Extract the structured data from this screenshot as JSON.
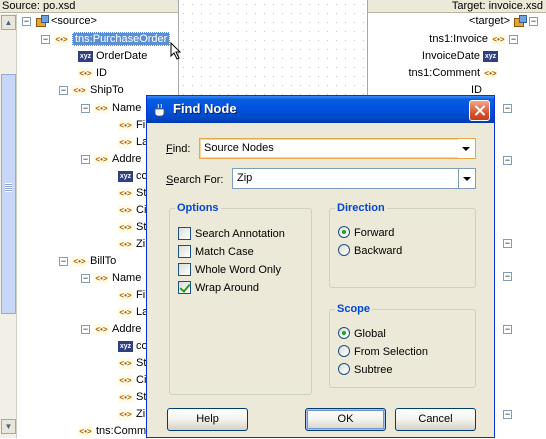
{
  "source": {
    "header": "Source: po.xsd",
    "tree": [
      {
        "label": "<source>",
        "kind": "root"
      },
      {
        "label": "tns:PurchaseOrder",
        "kind": "element",
        "selected": true
      },
      {
        "label": "OrderDate",
        "kind": "attribute"
      },
      {
        "label": "ID",
        "kind": "element"
      },
      {
        "label": "ShipTo",
        "kind": "element"
      },
      {
        "label": "Name",
        "kind": "element"
      },
      {
        "label": "Fi",
        "kind": "element"
      },
      {
        "label": "La",
        "kind": "element"
      },
      {
        "label": "Addre",
        "kind": "element"
      },
      {
        "label": "co",
        "kind": "attribute"
      },
      {
        "label": "St",
        "kind": "element"
      },
      {
        "label": "Ci",
        "kind": "element"
      },
      {
        "label": "St",
        "kind": "element"
      },
      {
        "label": "Zi",
        "kind": "element"
      },
      {
        "label": "BillTo",
        "kind": "element"
      },
      {
        "label": "Name",
        "kind": "element"
      },
      {
        "label": "Fi",
        "kind": "element"
      },
      {
        "label": "La",
        "kind": "element"
      },
      {
        "label": "Addre",
        "kind": "element"
      },
      {
        "label": "co",
        "kind": "attribute"
      },
      {
        "label": "St",
        "kind": "element"
      },
      {
        "label": "Ci",
        "kind": "element"
      },
      {
        "label": "St",
        "kind": "element"
      },
      {
        "label": "Zi",
        "kind": "element"
      },
      {
        "label": "tns:Comm",
        "kind": "element"
      }
    ]
  },
  "target": {
    "header": "Target: invoice.xsd",
    "tree": [
      {
        "label": "<target>"
      },
      {
        "label": "tns1:Invoice"
      },
      {
        "label": "InvoiceDate"
      },
      {
        "label": "tns1:Comment"
      },
      {
        "label": "ID"
      }
    ]
  },
  "dialog": {
    "title": "Find Node",
    "find_label": "Find:",
    "find_value": "Source Nodes",
    "search_for_label": "Search For:",
    "search_for_value": "Zip",
    "options": {
      "title": "Options",
      "items": [
        {
          "label": "Search Annotation",
          "checked": false
        },
        {
          "label": "Match Case",
          "checked": false
        },
        {
          "label": "Whole Word Only",
          "checked": false
        },
        {
          "label": "Wrap Around",
          "checked": true
        }
      ]
    },
    "direction": {
      "title": "Direction",
      "items": [
        {
          "label": "Forward",
          "checked": true
        },
        {
          "label": "Backward",
          "checked": false
        }
      ]
    },
    "scope": {
      "title": "Scope",
      "items": [
        {
          "label": "Global",
          "checked": true
        },
        {
          "label": "From Selection",
          "checked": false
        },
        {
          "label": "Subtree",
          "checked": false
        }
      ]
    },
    "buttons": {
      "help": "Help",
      "ok": "OK",
      "cancel": "Cancel"
    }
  },
  "colors": {
    "title_bar": "#0054e3",
    "group_title": "#0046d5",
    "selection": "#5a8fd6"
  }
}
